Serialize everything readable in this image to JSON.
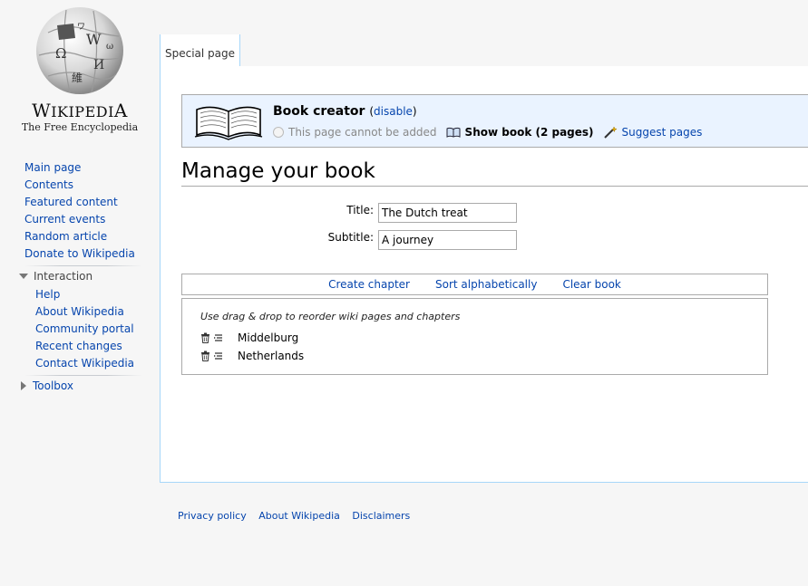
{
  "logo": {
    "wordmark_big": "W",
    "wordmark_rest": "IKIPEDI",
    "wordmark_end": "A",
    "tagline": "The Free Encyclopedia"
  },
  "nav": {
    "items": [
      "Main page",
      "Contents",
      "Featured content",
      "Current events",
      "Random article",
      "Donate to Wikipedia"
    ],
    "interaction": {
      "heading": "Interaction",
      "items": [
        "Help",
        "About Wikipedia",
        "Community portal",
        "Recent changes",
        "Contact Wikipedia"
      ]
    },
    "toolbox": {
      "heading": "Toolbox"
    }
  },
  "tab": {
    "label": "Special page"
  },
  "book_creator": {
    "title": "Book creator",
    "open_paren": "(",
    "disable_label": "disable",
    "close_paren": ")",
    "cannot_add": "This page cannot be added",
    "show_book": "Show book (2 pages)",
    "suggest": "Suggest pages"
  },
  "page": {
    "title": "Manage your book",
    "title_label": "Title:",
    "title_value": "The Dutch treat",
    "subtitle_label": "Subtitle:",
    "subtitle_value": "A journey"
  },
  "toolbar": {
    "create_chapter": "Create chapter",
    "sort": "Sort alphabetically",
    "clear": "Clear book"
  },
  "outline": {
    "hint": "Use drag & drop to reorder wiki pages and chapters",
    "items": [
      "Middelburg",
      "Netherlands"
    ]
  },
  "footer": {
    "links": [
      "Privacy policy",
      "About Wikipedia",
      "Disclaimers"
    ]
  },
  "colors": {
    "link": "#0645ad",
    "tab_border": "#a7d7f9",
    "book_creator_bg": "#eaf3ff"
  }
}
